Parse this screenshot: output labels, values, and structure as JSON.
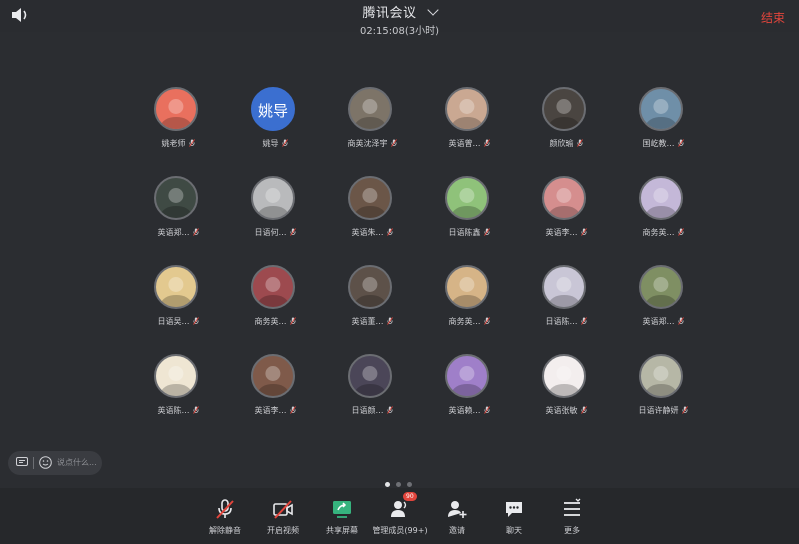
{
  "header": {
    "title": "腾讯会议",
    "duration": "02:15:08(3小时)",
    "end_label": "结束",
    "speaker_icon": "speaker-icon"
  },
  "participants": [
    {
      "name": "姚老师",
      "avatar_color": "#e9705e",
      "avatar_text": ""
    },
    {
      "name": "姚导",
      "avatar_color": "#3b6fd0",
      "avatar_text": "姚导"
    },
    {
      "name": "商英沈泽宇",
      "avatar_color": "#7d7468",
      "avatar_text": ""
    },
    {
      "name": "英语曾…",
      "avatar_color": "#caa892",
      "avatar_text": ""
    },
    {
      "name": "颜欣瑜",
      "avatar_color": "#4a4541",
      "avatar_text": ""
    },
    {
      "name": "国屹教…",
      "avatar_color": "#6f8fa8",
      "avatar_text": ""
    },
    {
      "name": "英语郑…",
      "avatar_color": "#3f4a44",
      "avatar_text": ""
    },
    {
      "name": "日语何…",
      "avatar_color": "#b9babc",
      "avatar_text": ""
    },
    {
      "name": "英语朱…",
      "avatar_color": "#6b5648",
      "avatar_text": ""
    },
    {
      "name": "日语陈鑫",
      "avatar_color": "#8fc27a",
      "avatar_text": ""
    },
    {
      "name": "英语李…",
      "avatar_color": "#d58e8e",
      "avatar_text": ""
    },
    {
      "name": "商务英…",
      "avatar_color": "#c4b8d8",
      "avatar_text": ""
    },
    {
      "name": "日语吴…",
      "avatar_color": "#e3c98f",
      "avatar_text": ""
    },
    {
      "name": "商务英…",
      "avatar_color": "#9d4a4f",
      "avatar_text": ""
    },
    {
      "name": "英语董…",
      "avatar_color": "#5d5149",
      "avatar_text": ""
    },
    {
      "name": "商务英…",
      "avatar_color": "#d6b487",
      "avatar_text": ""
    },
    {
      "name": "日语陈…",
      "avatar_color": "#c9c6d6",
      "avatar_text": ""
    },
    {
      "name": "英语郑…",
      "avatar_color": "#7f8f63",
      "avatar_text": ""
    },
    {
      "name": "英语陈…",
      "avatar_color": "#efe6d3",
      "avatar_text": ""
    },
    {
      "name": "英语李…",
      "avatar_color": "#7f5a4a",
      "avatar_text": ""
    },
    {
      "name": "日语颜…",
      "avatar_color": "#4b4658",
      "avatar_text": ""
    },
    {
      "name": "英语赖…",
      "avatar_color": "#9f7fc9",
      "avatar_text": ""
    },
    {
      "name": "英语张敏",
      "avatar_color": "#f3eeee",
      "avatar_text": ""
    },
    {
      "name": "日语许静妍",
      "avatar_color": "#b6b7a6",
      "avatar_text": ""
    }
  ],
  "chat": {
    "placeholder": "说点什么...",
    "chat_icon": "chat-bubble-icon",
    "emoji_icon": "emoji-icon"
  },
  "pager": {
    "pages": 3,
    "active": 0
  },
  "toolbar": {
    "items": [
      {
        "label": "解除静音",
        "icon": "mic-muted-icon"
      },
      {
        "label": "开启视频",
        "icon": "video-off-icon"
      },
      {
        "label": "共享屏幕",
        "icon": "share-screen-icon"
      },
      {
        "label": "管理成员(99+)",
        "icon": "members-icon",
        "badge": "90"
      },
      {
        "label": "邀请",
        "icon": "invite-icon"
      },
      {
        "label": "聊天",
        "icon": "chat-icon"
      },
      {
        "label": "更多",
        "icon": "more-icon"
      }
    ]
  },
  "colors": {
    "background": "#2b2d31",
    "end": "#e2453c",
    "share_green": "#36b37e",
    "mic_red": "#e2453c"
  }
}
